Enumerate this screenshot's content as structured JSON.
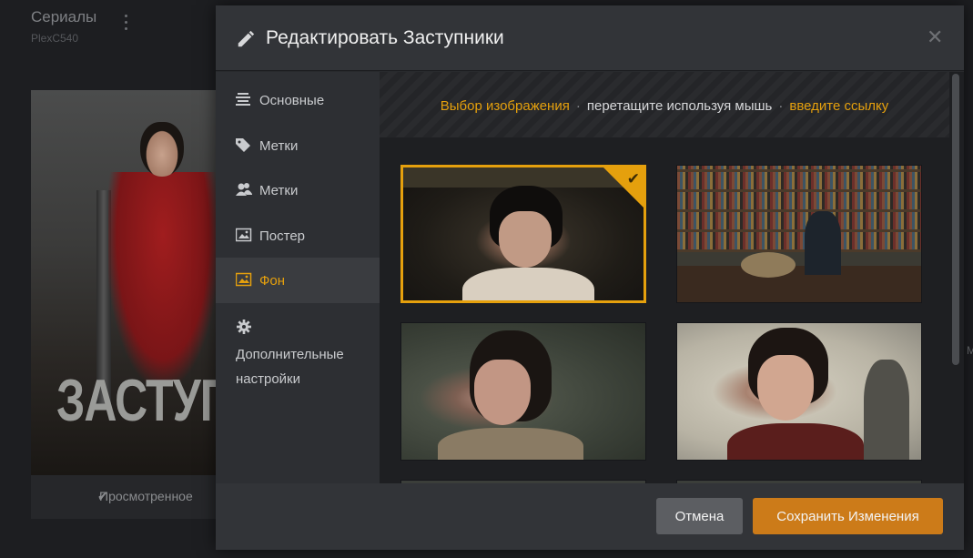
{
  "background": {
    "section_title": "Сериалы",
    "server_name": "PlexC540",
    "poster_title": "ЗАСТУПНИ",
    "watched_label": "Просмотренное",
    "edge_letter": "M"
  },
  "modal": {
    "title": "Редактировать Заступники",
    "close_symbol": "✕",
    "sidebar": {
      "items": [
        {
          "label": "Основные",
          "icon": "list-icon"
        },
        {
          "label": "Метки",
          "icon": "tags-icon"
        },
        {
          "label": "Метки",
          "icon": "people-icon"
        },
        {
          "label": "Постер",
          "icon": "image-icon"
        },
        {
          "label": "Фон",
          "icon": "image-icon",
          "active": true
        },
        {
          "label": "Дополнительные настройки",
          "icon": "gear-icon"
        }
      ]
    },
    "toolbar": {
      "choose_image": "Выбор изображения",
      "separator": "·",
      "drag_text": "перетащите используя мышь",
      "enter_link": "введите ссылку"
    },
    "footer": {
      "cancel_label": "Отмена",
      "save_label": "Сохранить Изменения"
    }
  },
  "colors": {
    "accent": "#e5a00d",
    "save_button": "#cc7b19",
    "cancel_button": "#5c5e62"
  }
}
